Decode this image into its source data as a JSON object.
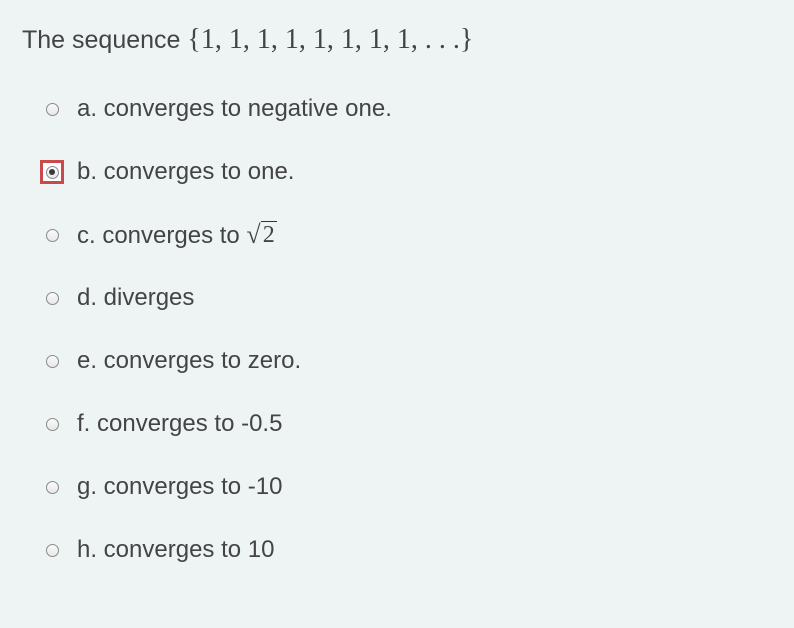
{
  "question": {
    "prefix": "The sequence ",
    "math": "{1, 1, 1, 1, 1, 1, 1, 1, . . .}"
  },
  "options": {
    "a": "a. converges to negative one.",
    "b": "b. converges to one.",
    "c_prefix": "c. converges to ",
    "c_sqrt_arg": "2",
    "d": "d. diverges",
    "e": "e. converges to zero.",
    "f": "f. converges to -0.5",
    "g": "g. converges to -10",
    "h": "h. converges to 10"
  },
  "selected": "b"
}
